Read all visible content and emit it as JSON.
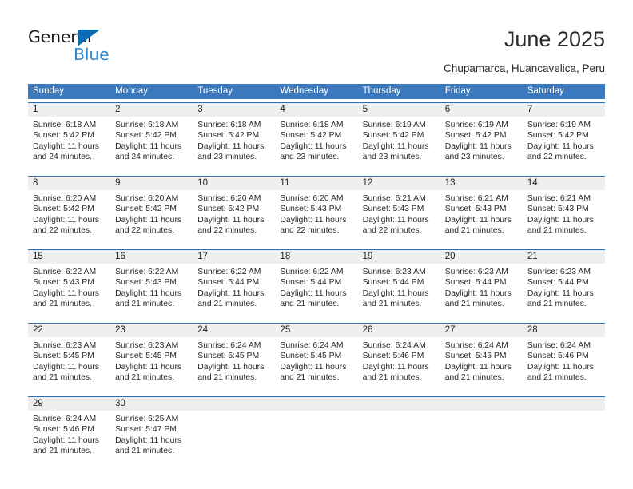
{
  "brand": {
    "name_top": "General",
    "name_bottom": "Blue",
    "color_dark": "#1b1b1b",
    "color_blue": "#2e8bd4",
    "triangle_color": "#0b6cb5"
  },
  "header": {
    "title": "June 2025",
    "subtitle": "Chupamarca, Huancavelica, Peru"
  },
  "theme": {
    "header_bg": "#3a79bd",
    "header_text": "#ffffff",
    "row_rule": "#2f6fae",
    "daynum_bg": "#efefef",
    "text": "#2a2a2a"
  },
  "weekdays": [
    "Sunday",
    "Monday",
    "Tuesday",
    "Wednesday",
    "Thursday",
    "Friday",
    "Saturday"
  ],
  "weeks": [
    [
      {
        "day": "1",
        "sunrise": "Sunrise: 6:18 AM",
        "sunset": "Sunset: 5:42 PM",
        "daylight": "Daylight: 11 hours and 24 minutes."
      },
      {
        "day": "2",
        "sunrise": "Sunrise: 6:18 AM",
        "sunset": "Sunset: 5:42 PM",
        "daylight": "Daylight: 11 hours and 24 minutes."
      },
      {
        "day": "3",
        "sunrise": "Sunrise: 6:18 AM",
        "sunset": "Sunset: 5:42 PM",
        "daylight": "Daylight: 11 hours and 23 minutes."
      },
      {
        "day": "4",
        "sunrise": "Sunrise: 6:18 AM",
        "sunset": "Sunset: 5:42 PM",
        "daylight": "Daylight: 11 hours and 23 minutes."
      },
      {
        "day": "5",
        "sunrise": "Sunrise: 6:19 AM",
        "sunset": "Sunset: 5:42 PM",
        "daylight": "Daylight: 11 hours and 23 minutes."
      },
      {
        "day": "6",
        "sunrise": "Sunrise: 6:19 AM",
        "sunset": "Sunset: 5:42 PM",
        "daylight": "Daylight: 11 hours and 23 minutes."
      },
      {
        "day": "7",
        "sunrise": "Sunrise: 6:19 AM",
        "sunset": "Sunset: 5:42 PM",
        "daylight": "Daylight: 11 hours and 22 minutes."
      }
    ],
    [
      {
        "day": "8",
        "sunrise": "Sunrise: 6:20 AM",
        "sunset": "Sunset: 5:42 PM",
        "daylight": "Daylight: 11 hours and 22 minutes."
      },
      {
        "day": "9",
        "sunrise": "Sunrise: 6:20 AM",
        "sunset": "Sunset: 5:42 PM",
        "daylight": "Daylight: 11 hours and 22 minutes."
      },
      {
        "day": "10",
        "sunrise": "Sunrise: 6:20 AM",
        "sunset": "Sunset: 5:42 PM",
        "daylight": "Daylight: 11 hours and 22 minutes."
      },
      {
        "day": "11",
        "sunrise": "Sunrise: 6:20 AM",
        "sunset": "Sunset: 5:43 PM",
        "daylight": "Daylight: 11 hours and 22 minutes."
      },
      {
        "day": "12",
        "sunrise": "Sunrise: 6:21 AM",
        "sunset": "Sunset: 5:43 PM",
        "daylight": "Daylight: 11 hours and 22 minutes."
      },
      {
        "day": "13",
        "sunrise": "Sunrise: 6:21 AM",
        "sunset": "Sunset: 5:43 PM",
        "daylight": "Daylight: 11 hours and 21 minutes."
      },
      {
        "day": "14",
        "sunrise": "Sunrise: 6:21 AM",
        "sunset": "Sunset: 5:43 PM",
        "daylight": "Daylight: 11 hours and 21 minutes."
      }
    ],
    [
      {
        "day": "15",
        "sunrise": "Sunrise: 6:22 AM",
        "sunset": "Sunset: 5:43 PM",
        "daylight": "Daylight: 11 hours and 21 minutes."
      },
      {
        "day": "16",
        "sunrise": "Sunrise: 6:22 AM",
        "sunset": "Sunset: 5:43 PM",
        "daylight": "Daylight: 11 hours and 21 minutes."
      },
      {
        "day": "17",
        "sunrise": "Sunrise: 6:22 AM",
        "sunset": "Sunset: 5:44 PM",
        "daylight": "Daylight: 11 hours and 21 minutes."
      },
      {
        "day": "18",
        "sunrise": "Sunrise: 6:22 AM",
        "sunset": "Sunset: 5:44 PM",
        "daylight": "Daylight: 11 hours and 21 minutes."
      },
      {
        "day": "19",
        "sunrise": "Sunrise: 6:23 AM",
        "sunset": "Sunset: 5:44 PM",
        "daylight": "Daylight: 11 hours and 21 minutes."
      },
      {
        "day": "20",
        "sunrise": "Sunrise: 6:23 AM",
        "sunset": "Sunset: 5:44 PM",
        "daylight": "Daylight: 11 hours and 21 minutes."
      },
      {
        "day": "21",
        "sunrise": "Sunrise: 6:23 AM",
        "sunset": "Sunset: 5:44 PM",
        "daylight": "Daylight: 11 hours and 21 minutes."
      }
    ],
    [
      {
        "day": "22",
        "sunrise": "Sunrise: 6:23 AM",
        "sunset": "Sunset: 5:45 PM",
        "daylight": "Daylight: 11 hours and 21 minutes."
      },
      {
        "day": "23",
        "sunrise": "Sunrise: 6:23 AM",
        "sunset": "Sunset: 5:45 PM",
        "daylight": "Daylight: 11 hours and 21 minutes."
      },
      {
        "day": "24",
        "sunrise": "Sunrise: 6:24 AM",
        "sunset": "Sunset: 5:45 PM",
        "daylight": "Daylight: 11 hours and 21 minutes."
      },
      {
        "day": "25",
        "sunrise": "Sunrise: 6:24 AM",
        "sunset": "Sunset: 5:45 PM",
        "daylight": "Daylight: 11 hours and 21 minutes."
      },
      {
        "day": "26",
        "sunrise": "Sunrise: 6:24 AM",
        "sunset": "Sunset: 5:46 PM",
        "daylight": "Daylight: 11 hours and 21 minutes."
      },
      {
        "day": "27",
        "sunrise": "Sunrise: 6:24 AM",
        "sunset": "Sunset: 5:46 PM",
        "daylight": "Daylight: 11 hours and 21 minutes."
      },
      {
        "day": "28",
        "sunrise": "Sunrise: 6:24 AM",
        "sunset": "Sunset: 5:46 PM",
        "daylight": "Daylight: 11 hours and 21 minutes."
      }
    ],
    [
      {
        "day": "29",
        "sunrise": "Sunrise: 6:24 AM",
        "sunset": "Sunset: 5:46 PM",
        "daylight": "Daylight: 11 hours and 21 minutes."
      },
      {
        "day": "30",
        "sunrise": "Sunrise: 6:25 AM",
        "sunset": "Sunset: 5:47 PM",
        "daylight": "Daylight: 11 hours and 21 minutes."
      },
      {
        "day": "",
        "sunrise": "",
        "sunset": "",
        "daylight": ""
      },
      {
        "day": "",
        "sunrise": "",
        "sunset": "",
        "daylight": ""
      },
      {
        "day": "",
        "sunrise": "",
        "sunset": "",
        "daylight": ""
      },
      {
        "day": "",
        "sunrise": "",
        "sunset": "",
        "daylight": ""
      },
      {
        "day": "",
        "sunrise": "",
        "sunset": "",
        "daylight": ""
      }
    ]
  ]
}
